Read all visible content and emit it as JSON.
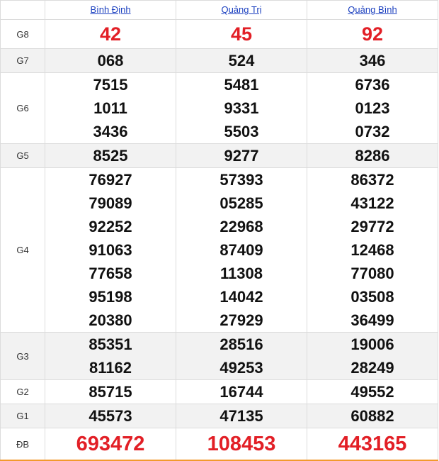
{
  "header": {
    "provinces": [
      "Bình Định",
      "Quảng Trị",
      "Quảng Bình"
    ]
  },
  "rows": [
    {
      "label": "G8",
      "values": [
        [
          "42"
        ],
        [
          "45"
        ],
        [
          "92"
        ]
      ]
    },
    {
      "label": "G7",
      "values": [
        [
          "068"
        ],
        [
          "524"
        ],
        [
          "346"
        ]
      ]
    },
    {
      "label": "G6",
      "values": [
        [
          "7515",
          "1011",
          "3436"
        ],
        [
          "5481",
          "9331",
          "5503"
        ],
        [
          "6736",
          "0123",
          "0732"
        ]
      ]
    },
    {
      "label": "G5",
      "values": [
        [
          "8525"
        ],
        [
          "9277"
        ],
        [
          "8286"
        ]
      ]
    },
    {
      "label": "G4",
      "values": [
        [
          "76927",
          "79089",
          "92252",
          "91063",
          "77658",
          "95198",
          "20380"
        ],
        [
          "57393",
          "05285",
          "22968",
          "87409",
          "11308",
          "14042",
          "27929"
        ],
        [
          "86372",
          "43122",
          "29772",
          "12468",
          "77080",
          "03508",
          "36499"
        ]
      ]
    },
    {
      "label": "G3",
      "values": [
        [
          "85351",
          "81162"
        ],
        [
          "28516",
          "49253"
        ],
        [
          "19006",
          "28249"
        ]
      ]
    },
    {
      "label": "G2",
      "values": [
        [
          "85715"
        ],
        [
          "16744"
        ],
        [
          "49552"
        ]
      ]
    },
    {
      "label": "G1",
      "values": [
        [
          "45573"
        ],
        [
          "47135"
        ],
        [
          "60882"
        ]
      ]
    },
    {
      "label": "ĐB",
      "values": [
        [
          "693472"
        ],
        [
          "108453"
        ],
        [
          "443165"
        ]
      ]
    }
  ],
  "colors": {
    "link": "#1a3fbf",
    "highlight": "#e21f26",
    "stripe": "#f2f2f2",
    "bottom_border": "#f29a2e"
  }
}
